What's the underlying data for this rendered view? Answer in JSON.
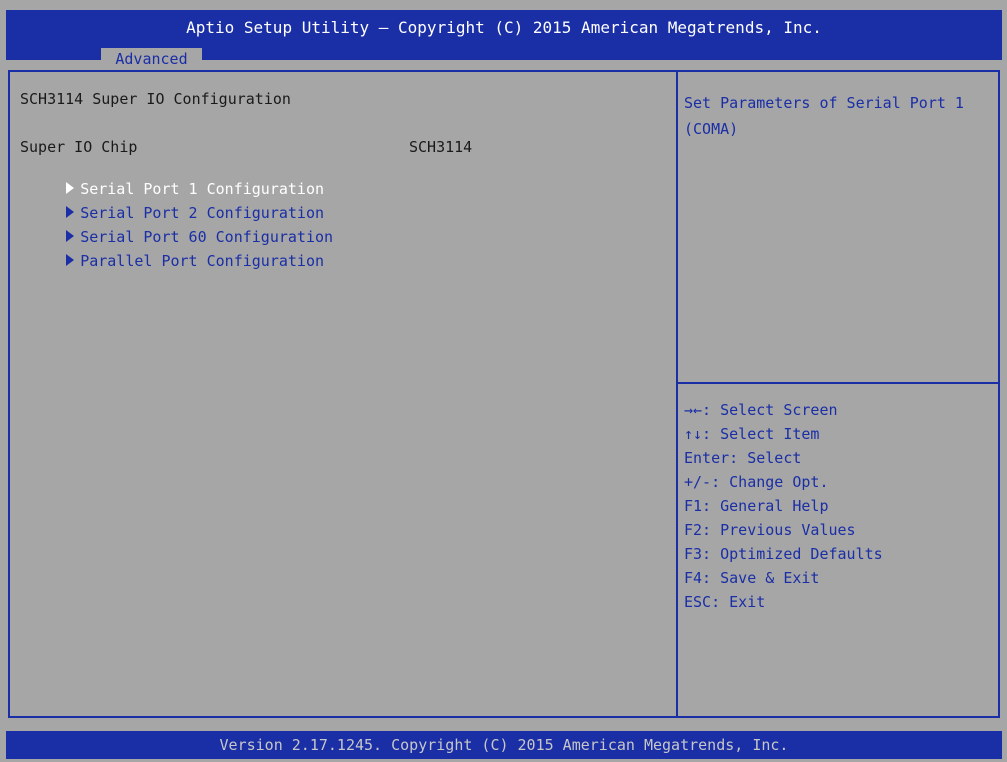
{
  "header": {
    "title": "Aptio Setup Utility – Copyright (C) 2015 American Megatrends, Inc.",
    "active_tab": "Advanced"
  },
  "main": {
    "section_title": "SCH3114 Super IO Configuration",
    "super_io_label": "Super IO Chip",
    "super_io_value": "SCH3114",
    "menu_items": [
      {
        "label": "Serial Port 1 Configuration",
        "selected": true
      },
      {
        "label": "Serial Port 2 Configuration",
        "selected": false
      },
      {
        "label": "Serial Port 60 Configuration",
        "selected": false
      },
      {
        "label": "Parallel Port Configuration",
        "selected": false
      }
    ]
  },
  "help": {
    "text": "Set Parameters of Serial Port 1 (COMA)"
  },
  "keys": [
    "→←: Select Screen",
    "↑↓: Select Item",
    "Enter: Select",
    "+/-: Change Opt.",
    "F1: General Help",
    "F2: Previous Values",
    "F3: Optimized Defaults",
    "F4: Save & Exit",
    "ESC: Exit"
  ],
  "footer": {
    "text": "Version 2.17.1245. Copyright (C) 2015 American Megatrends, Inc."
  },
  "colors": {
    "bios_blue": "#1a2ea6",
    "bios_gray": "#a6a6a6",
    "text_dark": "#1a1a1a",
    "highlight": "#ffffff"
  }
}
